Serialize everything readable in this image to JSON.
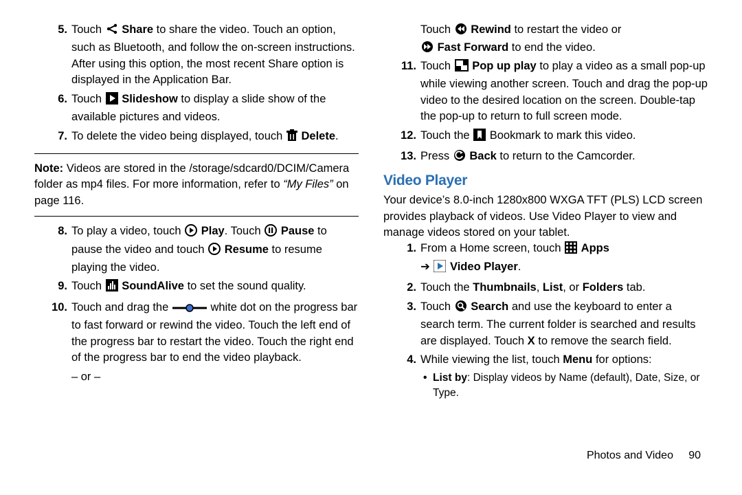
{
  "leftCol": {
    "items": [
      {
        "n": "5.",
        "pre": "Touch ",
        "bold1": "Share",
        "post": " to share the video. Touch an option, such as Bluetooth, and follow the on-screen instructions. After using this option, the most recent Share option is displayed in the Application Bar.",
        "icon": "share"
      },
      {
        "n": "6.",
        "pre": "Touch ",
        "bold1": "Slideshow",
        "post": " to display a slide show of the available pictures and videos.",
        "icon": "slideshow"
      },
      {
        "n": "7.",
        "pre": "To delete the video being displayed, touch ",
        "bold1": "Delete",
        "post": ".",
        "icon": "delete",
        "iconBefore": true
      }
    ],
    "noteLead": "Note:",
    "noteBody": " Videos are stored in the /storage/sdcard0/DCIM/Camera folder as mp4 files. For more information, refer to ",
    "noteItalic": "“My Files”",
    "noteEnd": " on page 116.",
    "items2": {
      "i8": {
        "n": "8.",
        "t1": "To play a video, touch ",
        "b1": "Play",
        "t2": ". Touch ",
        "b2": "Pause",
        "t3": " to pause the video and touch ",
        "b3": "Resume",
        "t4": " to resume playing the video."
      },
      "i9": {
        "n": "9.",
        "t1": "Touch ",
        "b1": "SoundAlive",
        "t2": " to set the sound quality."
      },
      "i10": {
        "n": "10.",
        "t1": "Touch and drag the ",
        "t2": " white dot on the progress bar to fast forward or rewind the video. Touch the left end of the progress bar to restart the video. Touch the right end of the progress bar to end the video playback."
      },
      "or": "– or –"
    }
  },
  "rightCol": {
    "top": {
      "line1a": "Touch ",
      "b1": "Rewind",
      "line1b": " to restart the video or",
      "line2b": "Fast Forward",
      "line2c": " to end the video."
    },
    "i11": {
      "n": "11.",
      "t1": "Touch ",
      "b1": "Pop up play",
      "t2": " to play a video as a small pop-up while viewing another screen. Touch and drag the pop-up video to the desired location on the screen. Double-tap the pop-up to return to full screen mode."
    },
    "i12": {
      "n": "12.",
      "t1": "Touch the ",
      "t2": " Bookmark to mark this video."
    },
    "i13": {
      "n": "13.",
      "t1": "Press ",
      "b1": "Back",
      "t2": " to return to the Camcorder."
    },
    "sectionTitle": "Video Player",
    "intro": "Your device’s 8.0-inch 1280x800 WXGA TFT (PLS) LCD screen provides playback of videos. Use Video Player to view and manage videos stored on your tablet.",
    "s1": {
      "n": "1.",
      "t1": "From a Home screen, touch ",
      "b1": "Apps",
      "arrow": "➔ ",
      "b2": "Video Player",
      "t2": "."
    },
    "s2": {
      "n": "2.",
      "t1": "Touch the ",
      "b1": "Thumbnails",
      "t2": ", ",
      "b2": "List",
      "t3": ", or ",
      "b3": "Folders",
      "t4": " tab."
    },
    "s3": {
      "n": "3.",
      "t1": "Touch ",
      "b1": "Search",
      "t2": " and use the keyboard to enter a search term. The current folder is searched and results are displayed. Touch ",
      "b2": "X",
      "t3": " to remove the search field."
    },
    "s4": {
      "n": "4.",
      "t1": "While viewing the list, touch ",
      "b1": "Menu",
      "t2": " for options:"
    },
    "bullet1": {
      "b": "List by",
      "t": ": Display videos by Name (default), Date, Size, or Type."
    }
  },
  "footer": {
    "section": "Photos and Video",
    "page": "90"
  }
}
